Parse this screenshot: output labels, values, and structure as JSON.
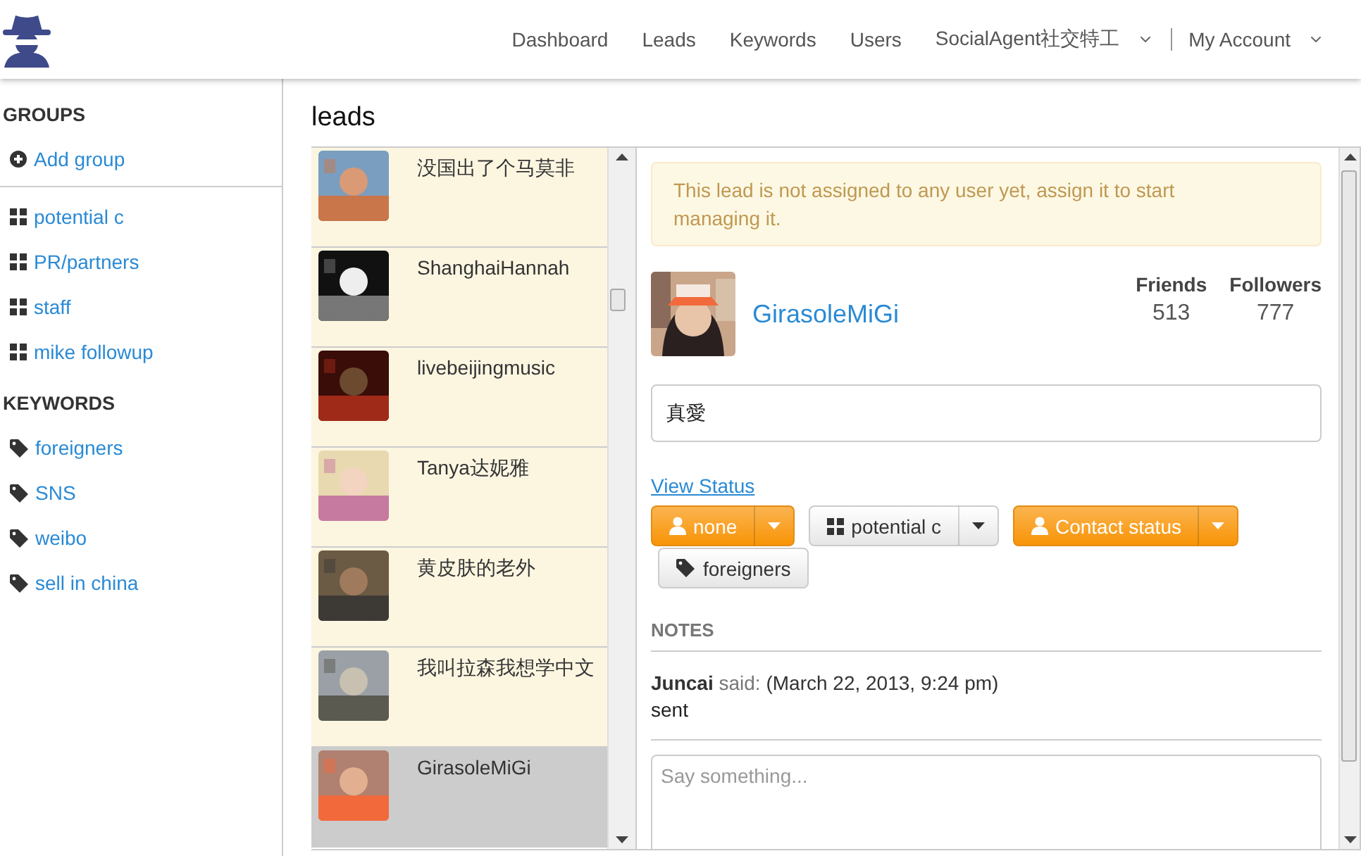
{
  "nav": {
    "items": [
      {
        "label": "Dashboard",
        "dropdown": false
      },
      {
        "label": "Leads",
        "dropdown": false
      },
      {
        "label": "Keywords",
        "dropdown": false
      },
      {
        "label": "Users",
        "dropdown": false
      },
      {
        "label": "SocialAgent社交特工",
        "dropdown": true
      },
      {
        "label": "My Account",
        "dropdown": true
      }
    ]
  },
  "sidebar": {
    "groups": {
      "heading": "GROUPS",
      "add": "Add group",
      "items": [
        "potential c",
        "PR/partners",
        "staff",
        "mike followup"
      ]
    },
    "keywords": {
      "heading": "KEYWORDS",
      "items": [
        "foreigners",
        "SNS",
        "weibo",
        "sell in china"
      ]
    }
  },
  "page_title": "leads",
  "leads": [
    {
      "name": "没国出了个马莫非",
      "selected": false
    },
    {
      "name": "ShanghaiHannah",
      "selected": false
    },
    {
      "name": "livebeijingmusic",
      "selected": false
    },
    {
      "name": "Tanya达妮雅",
      "selected": false
    },
    {
      "name": "黄皮肤的老外",
      "selected": false
    },
    {
      "name": "我叫拉森我想学中文",
      "selected": false
    },
    {
      "name": "GirasoleMiGi",
      "selected": true
    }
  ],
  "detail": {
    "alert": "This lead is not assigned to any user yet, assign it to start managing it.",
    "name": "GirasoleMiGi",
    "stats": [
      {
        "label": "Friends",
        "value": "513"
      },
      {
        "label": "Followers",
        "value": "777"
      }
    ],
    "bio": "真愛",
    "link": "View Status",
    "buttons": [
      {
        "kind": "assignee",
        "label": "none"
      },
      {
        "kind": "group",
        "label": "potential c"
      },
      {
        "kind": "contact",
        "label": "Contact status"
      }
    ],
    "tags": [
      "foreigners"
    ],
    "notes_heading": "NOTES",
    "notes": [
      {
        "author": "Juncai",
        "said": "said:",
        "date": "(March 22, 2013, 9:24 pm)",
        "text": "sent"
      }
    ],
    "comment_placeholder": "Say something..."
  }
}
